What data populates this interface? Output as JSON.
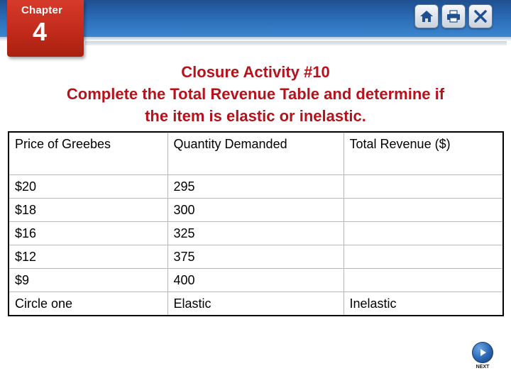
{
  "header": {
    "chapter_label": "Chapter",
    "chapter_number": "4",
    "buttons": [
      {
        "icon": "home-icon"
      },
      {
        "icon": "print-icon"
      },
      {
        "icon": "close-icon"
      }
    ]
  },
  "title": {
    "line1": "Closure Activity #10",
    "line2": "Complete the Total Revenue Table and determine if",
    "line3": "the item is elastic or inelastic."
  },
  "table": {
    "headers": [
      "Price of Greebes",
      "Quantity Demanded",
      "Total Revenue ($)"
    ],
    "rows": [
      [
        "$20",
        "295",
        ""
      ],
      [
        "$18",
        "300",
        ""
      ],
      [
        "$16",
        "325",
        ""
      ],
      [
        "$12",
        "375",
        ""
      ],
      [
        "$9",
        "400",
        ""
      ]
    ],
    "final_row": [
      "Circle one",
      "Elastic",
      "Inelastic"
    ]
  },
  "footer": {
    "next_label": "NEXT",
    "next_icon": "play-arrow-icon"
  },
  "colors": {
    "title": "#b5121b",
    "chapter_tab": "#c22a1b",
    "header_band": "#2a6ab4"
  }
}
